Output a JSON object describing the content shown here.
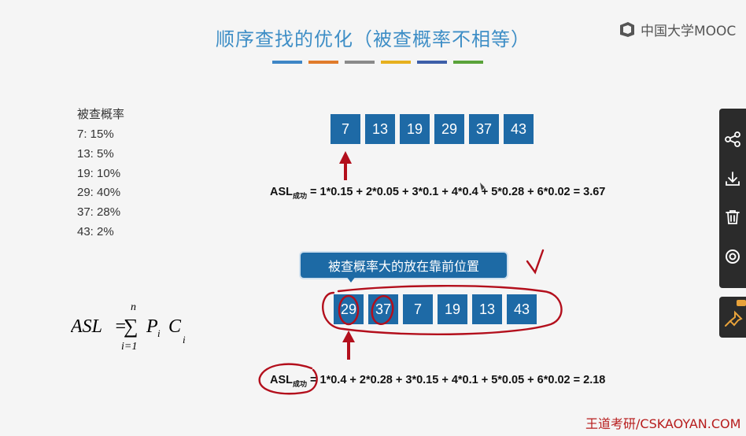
{
  "title": "顺序查找的优化（被查概率不相等）",
  "brand": {
    "name": "中国大学MOOC"
  },
  "stripe_colors": [
    "#3e86c6",
    "#e07b2b",
    "#8a8a8a",
    "#e6b01e",
    "#3d5ea8",
    "#5aa33a"
  ],
  "probabilities": {
    "heading": "被查概率",
    "items": [
      "7: 15%",
      "13: 5%",
      "19: 10%",
      "29: 40%",
      "37: 28%",
      "43: 2%"
    ]
  },
  "array_original": [
    "7",
    "13",
    "19",
    "29",
    "37",
    "43"
  ],
  "formula_original": {
    "asl": "ASL",
    "sub": "成功",
    "expr": " = 1*0.15 + 2*0.05 + 3*0.1 + 4*0.4 + 5*0.28 + 6*0.02 = 3.67"
  },
  "callout": "被查概率大的放在靠前位置",
  "array_sorted": [
    "29",
    "37",
    "7",
    "19",
    "13",
    "43"
  ],
  "formula_sorted": {
    "asl": "ASL",
    "sub": "成功",
    "expr": " = 1*0.4 + 2*0.28 + 3*0.15 + 4*0.1 + 5*0.05 + 6*0.02 = 2.18"
  },
  "asl_general": {
    "lhs": "ASL",
    "sum_top": "n",
    "sum_bottom": "i=1",
    "p": "P",
    "p_sub": "i",
    "c": "C",
    "c_sub": "i"
  },
  "sidebar": {
    "icons": [
      "share-icon",
      "download-icon",
      "delete-icon",
      "settings-icon"
    ],
    "pin_icon": "pin-icon"
  },
  "watermark": "王道考研/CSKAOYAN.COM",
  "colors": {
    "title": "#3e8ec6",
    "cell": "#1e6aa6",
    "annotation": "#b30f1c",
    "sidebar": "#2b2b2b"
  }
}
